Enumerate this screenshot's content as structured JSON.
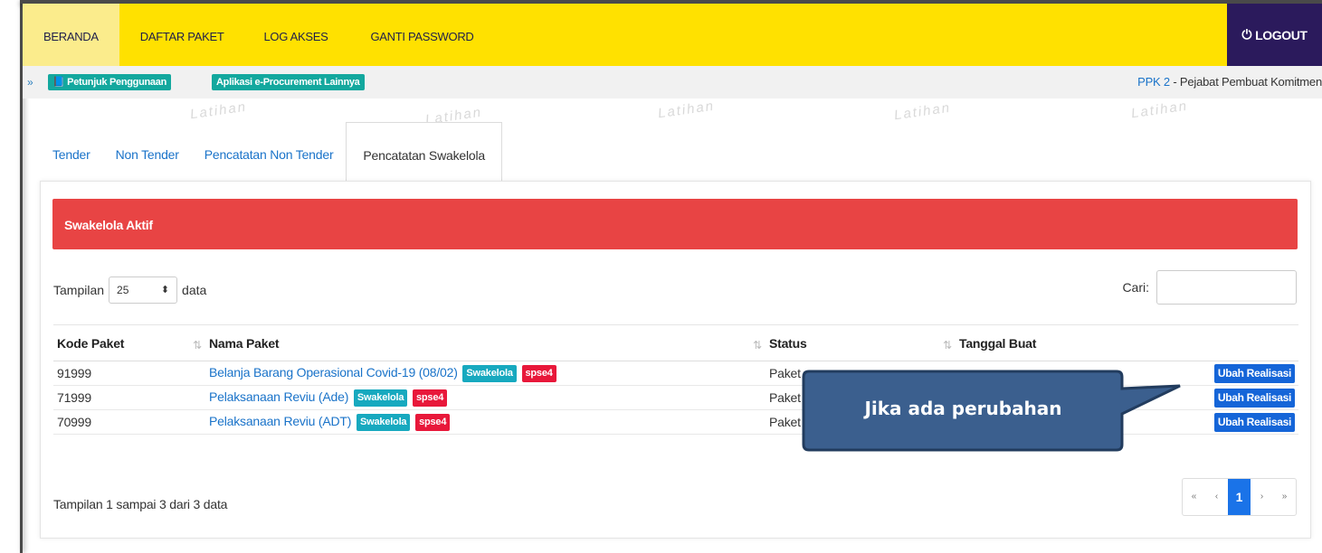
{
  "nav": {
    "items": [
      "BERANDA",
      "DAFTAR PAKET",
      "LOG AKSES",
      "GANTI PASSWORD"
    ],
    "logout_label": "LOGOUT"
  },
  "subbar": {
    "help_label": "Petunjuk Penggunaan",
    "other_apps_label": "Aplikasi e-Procurement Lainnya",
    "role_link": "PPK 2",
    "role_text": " - Pejabat Pembuat Komitmen"
  },
  "watermark": "Latihan",
  "tabs": [
    "Tender",
    "Non Tender",
    "Pencatatan Non Tender",
    "Pencatatan Swakelola"
  ],
  "panel": {
    "title": "Swakelola Aktif",
    "length_prefix": "Tampilan",
    "length_value": "25",
    "length_suffix": "data",
    "search_label": "Cari:",
    "search_value": ""
  },
  "table": {
    "headers": [
      "Kode Paket",
      "Nama Paket",
      "Status",
      "Tanggal Buat"
    ],
    "rows": [
      {
        "kode": "91999",
        "nama": "Belanja Barang Operasional Covid-19 (08/02)",
        "tag1": "Swakelola",
        "tag2": "spse4",
        "status": "Paket",
        "action": "Ubah Realisasi"
      },
      {
        "kode": "71999",
        "nama": "Pelaksanaan Reviu (Ade)",
        "tag1": "Swakelola",
        "tag2": "spse4",
        "status": "Paket",
        "action": "Ubah Realisasi"
      },
      {
        "kode": "70999",
        "nama": "Pelaksanaan Reviu (ADT)",
        "tag1": "Swakelola",
        "tag2": "spse4",
        "status": "Paket",
        "action": "Ubah Realisasi"
      }
    ],
    "info": "Tampilan 1 sampai 3 dari 3 data"
  },
  "pager": {
    "first": "«",
    "prev": "‹",
    "current": "1",
    "next": "›",
    "last": "»"
  },
  "callout": {
    "text": "Jika ada perubahan"
  },
  "colors": {
    "topbar": "#ffe100",
    "logout_bg": "#2b1a5c",
    "panel_title_bg": "#e84444",
    "link": "#1a73c9",
    "tag_swakelola": "#17a9bf",
    "tag_spse": "#e8183a",
    "button": "#1565d8",
    "callout_bg": "#3b5f8e"
  }
}
